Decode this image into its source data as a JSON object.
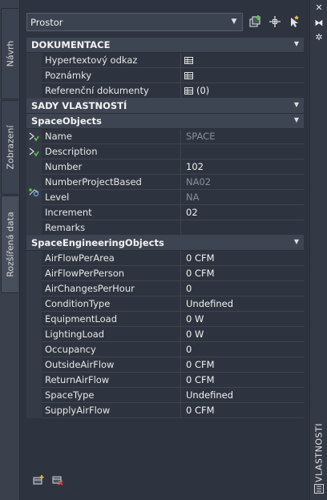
{
  "panel_title": "VLASTNOSTI",
  "left_tabs": [
    {
      "label": "Návrh"
    },
    {
      "label": "Zobrazení"
    },
    {
      "label": "Rozšířená data"
    }
  ],
  "selector": {
    "value": "Prostor"
  },
  "sections": {
    "dokumentace": "DOKUMENTACE",
    "sady": "SADY VLASTNOSTÍ",
    "space_objects": "SpaceObjects",
    "space_engineering": "SpaceEngineeringObjects"
  },
  "doc_rows": [
    {
      "name": "Hypertextový odkaz",
      "value": ""
    },
    {
      "name": "Poznámky",
      "value": ""
    },
    {
      "name": "Referenční dokumenty",
      "value": "(0)"
    }
  ],
  "space_rows": [
    {
      "name": "Name",
      "value": "SPACE"
    },
    {
      "name": "Description",
      "value": ""
    },
    {
      "name": "Number",
      "value": "102"
    },
    {
      "name": "NumberProjectBased",
      "value": "NA02"
    },
    {
      "name": "Level",
      "value": "NA"
    },
    {
      "name": "Increment",
      "value": "02"
    },
    {
      "name": "Remarks",
      "value": ""
    }
  ],
  "eng_rows": [
    {
      "name": "AirFlowPerArea",
      "value": "0 CFM"
    },
    {
      "name": "AirFlowPerPerson",
      "value": "0 CFM"
    },
    {
      "name": "AirChangesPerHour",
      "value": "0"
    },
    {
      "name": "ConditionType",
      "value": "Undefined"
    },
    {
      "name": "EquipmentLoad",
      "value": "0 W"
    },
    {
      "name": "LightingLoad",
      "value": "0 W"
    },
    {
      "name": "Occupancy",
      "value": "0"
    },
    {
      "name": "OutsideAirFlow",
      "value": "0 CFM"
    },
    {
      "name": "ReturnAirFlow",
      "value": "0 CFM"
    },
    {
      "name": "SpaceType",
      "value": "Undefined"
    },
    {
      "name": "SupplyAirFlow",
      "value": "0 CFM"
    }
  ],
  "colors": {
    "panel_bg": "#2e343f",
    "category_bg": "#3e4552",
    "accent_green": "#5cc34a",
    "accent_yellow": "#e8c34a"
  }
}
